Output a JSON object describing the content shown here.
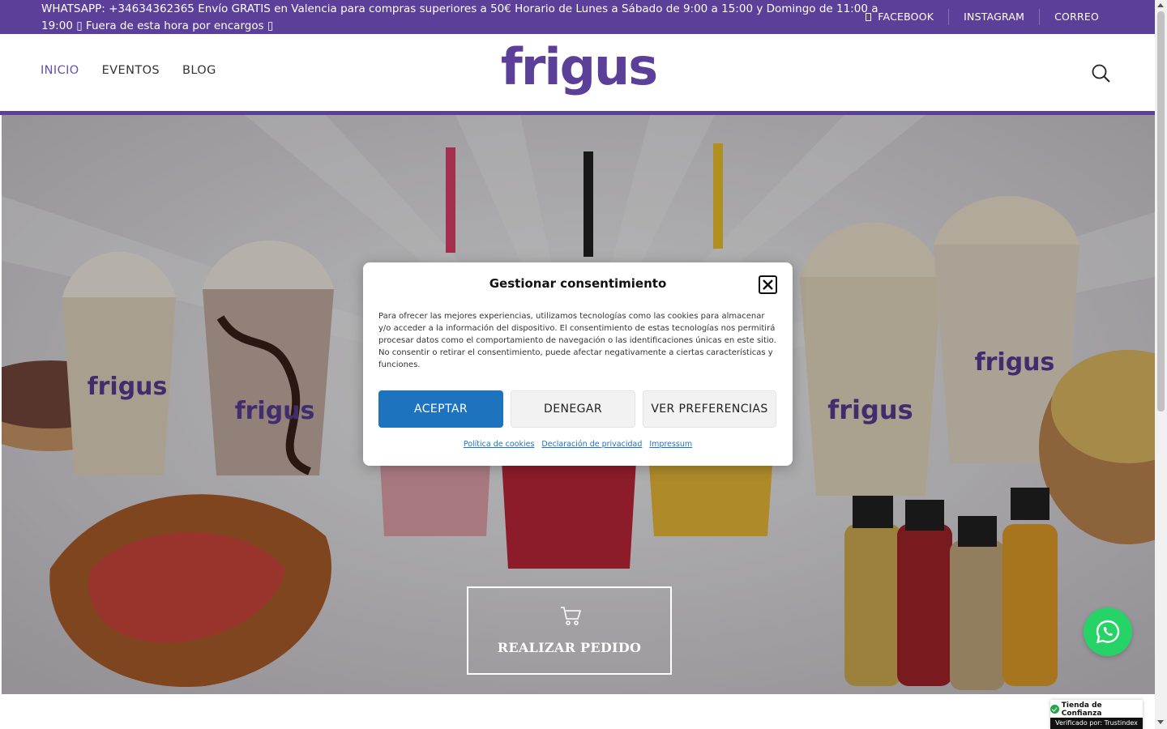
{
  "topbar": {
    "notice": "WHATSAPP: +34634362365 Envío GRATIS en Valencia para compras superiores a 50€ Horario de Lunes a Sábado de 9:00 a 15:00 y Domingo de 11:00 a 19:00 ▯ Fuera de esta hora por encargos ▯",
    "links": [
      "FACEBOOK",
      "INSTAGRAM",
      "CORREO"
    ]
  },
  "header": {
    "nav": [
      "INICIO",
      "EVENTOS",
      "BLOG"
    ],
    "logo_text": "frigus"
  },
  "hero": {
    "cta_label": "REALIZAR PEDIDO"
  },
  "consent_modal": {
    "title": "Gestionar consentimiento",
    "body": "Para ofrecer las mejores experiencias, utilizamos tecnologías como las cookies para almacenar y/o acceder a la información del dispositivo. El consentimiento de estas tecnologías nos permitirá procesar datos como el comportamiento de navegación o las identificaciones únicas en este sitio. No consentir o retirar el consentimiento, puede afectar negativamente a ciertas características y funciones.",
    "buttons": {
      "accept": "ACEPTAR",
      "deny": "DENEGAR",
      "preferences": "VER PREFERENCIAS"
    },
    "links": [
      "Política de cookies",
      "Declaración de privacidad",
      "Impressum"
    ]
  },
  "trust_badge": {
    "title": "Tienda de Confianza",
    "subtitle": "Verificado por: Trustindex"
  },
  "colors": {
    "brand_purple": "#5b3f98",
    "accept_blue": "#1e73be",
    "whatsapp_green": "#25d366"
  }
}
